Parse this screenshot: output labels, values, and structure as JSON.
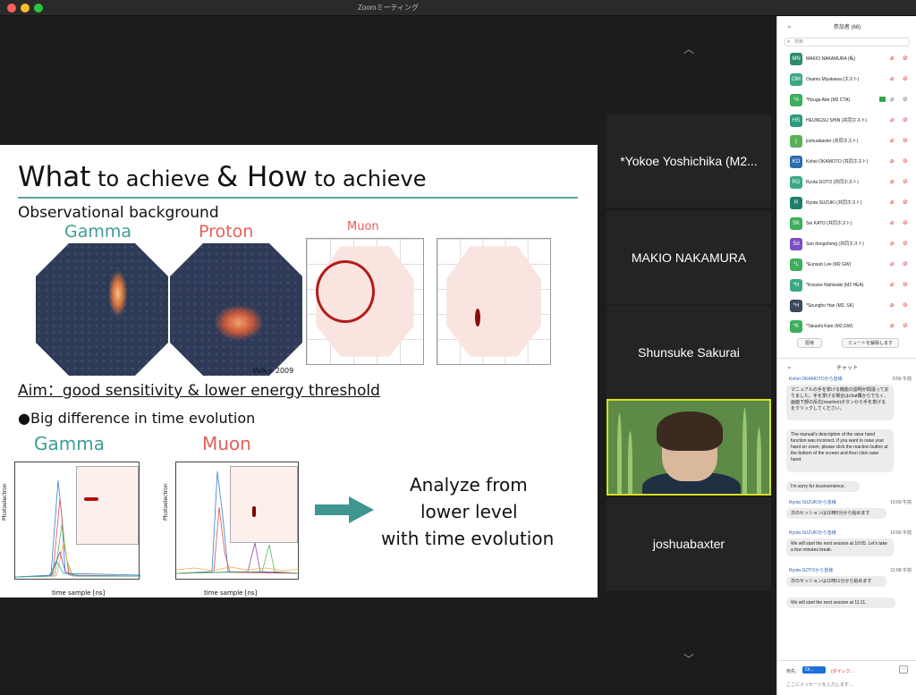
{
  "window": {
    "title": "Zoomミーティング"
  },
  "stage": {
    "up_chevron": "︿",
    "down_chevron": "﹀"
  },
  "slide": {
    "title_1": "What",
    "title_2": " to achieve ",
    "title_3": "& How",
    "title_4": " to achieve",
    "obs_bg": "Observational background",
    "gamma": "Gamma",
    "proton": "Proton",
    "muon": "Muon",
    "cite": "Volk+ 2009",
    "aim": "Aim：good sensitivity & lower energy threshold",
    "bullet": "●Big difference in time evolution",
    "gamma2": "Gamma",
    "muon2": "Muon",
    "ylabel": "Photoelectron",
    "xlabel": "time sample [ns]",
    "analyze_1": "Analyze from",
    "analyze_2": "lower level",
    "analyze_3": "with time evolution",
    "yticks_left": [
      "30",
      "25",
      "20",
      "15",
      "10",
      "5",
      "0"
    ],
    "yticks_right": [
      "14",
      "12",
      "10",
      "8",
      "6",
      "4",
      "2",
      "0"
    ],
    "xticks": [
      "0",
      "5",
      "10",
      "15",
      "20",
      "25",
      "30",
      "35",
      "40"
    ]
  },
  "tiles": [
    {
      "name": "*Yokoe Yoshichika (M2..."
    },
    {
      "name": "MAKIO NAKAMURA"
    },
    {
      "name": "Shunsuke Sakurai"
    },
    {
      "name": ""
    },
    {
      "name": "joshuabaxter"
    }
  ],
  "participants_panel": {
    "header": "参加者 (68)",
    "search_placeholder": "検索",
    "invite_label": "招待",
    "unmute_all_label": "ミュートを解除します",
    "people": [
      {
        "initials": "MN",
        "name": "MAKIO NAKAMURA (私)",
        "color": "#2e8b6e"
      },
      {
        "initials": "OM",
        "name": "Osamu Miyakawa (ホスト)",
        "color": "#3aa786"
      },
      {
        "initials": "*A",
        "name": "*Hyuga Abe (M2 CTA)",
        "color": "#3dae5c"
      },
      {
        "initials": "HS",
        "name": "HEUNGSU SHIN (共同ホスト)",
        "color": "#2f9a7d"
      },
      {
        "initials": "j",
        "name": "joshuabaxter (共同ホスト)",
        "color": "#5bb05a"
      },
      {
        "initials": "KO",
        "name": "Kohei OKAMOTO (共同ホスト)",
        "color": "#2a6db3"
      },
      {
        "initials": "RG",
        "name": "Ryota GOTO (共同ホスト)",
        "color": "#3aa786"
      },
      {
        "initials": "R",
        "name": "Ryota SUZUKI (共同ホスト)",
        "color": "#1f7f6a"
      },
      {
        "initials": "SK",
        "name": "Sei KATO (共同ホスト)",
        "color": "#3dae5c"
      },
      {
        "initials": "Sd",
        "name": "Sun dongsheng (共同ホスト)",
        "color": "#7a4fc3"
      },
      {
        "initials": "*L",
        "name": "*Eunsub Lee (M2 GW)",
        "color": "#3dae5c"
      },
      {
        "initials": "*N",
        "name": "*Kosuke Nishiwaki (M2 HEA)",
        "color": "#3aa786"
      },
      {
        "initials": "*H",
        "name": "*Seungho Han (M2, SK)",
        "color": "#3b4a5e"
      },
      {
        "initials": "*K",
        "name": "*Takashi Kato (M2,GW)",
        "color": "#3dae5c"
      }
    ]
  },
  "chat_panel": {
    "header": "チャット",
    "messages": [
      {
        "from": "Kohei OKAMOTOから皆様",
        "time": "9:56 午前",
        "text": "マニュアルの手を挙げる機能の説明が間違っておりました。手を挙げる場合はchat欄からでなく、画面下部の反応(reaction)ボタンから手を挙げるをクリックしてください。"
      },
      {
        "from": "",
        "time": "",
        "text": "The manual's description of the raise hand function was incorrect. If you want to raise your hand on zoom, please click the reaction button at the bottom of the screen and then click raise hand."
      },
      {
        "from": "",
        "time": "",
        "text": "I'm sorry for inconvenience."
      },
      {
        "from": "Ryota SUZUKIから皆様",
        "time": "10:00 午前",
        "text": "次のセッションは10時5分から始めます"
      },
      {
        "from": "Ryota SUZUKIから皆様",
        "time": "10:00 午前",
        "text": "We will start the next session at 10:05. Let's take a few minutes break."
      },
      {
        "from": "Ryota GOTOから皆様",
        "time": "11:08 午前",
        "text": "次のセッションは11時11分から始めます"
      },
      {
        "from": "",
        "time": "",
        "text": "We will start the next session at 11:11."
      }
    ],
    "to_label": "宛先：",
    "to_value": "Ot...",
    "dm_label": "(ダイレク...",
    "more_label": "…",
    "input_placeholder": "ここにメッセージを入力します..."
  },
  "colors": {
    "accent_teal": "#3f958f",
    "title_red": "#e4605a",
    "video_border": "#d7e11f"
  }
}
